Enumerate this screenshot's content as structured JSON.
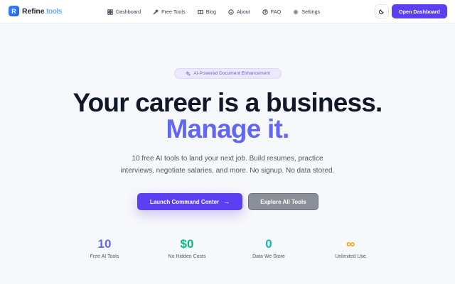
{
  "nav": {
    "logo_letter": "R",
    "logo_name": "Refine",
    "logo_tld": ".tools",
    "items": [
      {
        "label": "Dashboard",
        "icon": "grid-icon"
      },
      {
        "label": "Free Tools",
        "icon": "wrench-icon"
      },
      {
        "label": "Blog",
        "icon": "book-icon"
      },
      {
        "label": "About",
        "icon": "info-icon"
      },
      {
        "label": "FAQ",
        "icon": "help-circle-icon"
      },
      {
        "label": "Settings",
        "icon": "gear-icon"
      }
    ],
    "theme_icon": "moon-icon",
    "cta_label": "Open Dashboard"
  },
  "hero": {
    "badge": "AI-Powered Document Enhancement",
    "badge_icon": "sparkle-icon",
    "headline": "Your career is a business.",
    "headline_accent": "Manage it.",
    "subtext_line1": "10 free AI tools to land your next job. Build resumes, practice",
    "subtext_line2": "interviews, negotiate salaries, and more. No signup. No data stored.",
    "primary_button": "Launch Command Center",
    "secondary_button": "Explore All Tools"
  },
  "stats": [
    {
      "value": "10",
      "label": "Free AI Tools",
      "color": "#6366f1"
    },
    {
      "value": "$0",
      "label": "No Hidden Costs",
      "color": "#10b981"
    },
    {
      "value": "0",
      "label": "Data We Store",
      "color": "#14b8a6"
    },
    {
      "value": "∞",
      "label": "Unlimited Use",
      "color": "#f59e0b"
    }
  ],
  "colors": {
    "accent": "#5b3ff0",
    "accent_text": "#6366f1",
    "background": "#f7f8fb"
  }
}
